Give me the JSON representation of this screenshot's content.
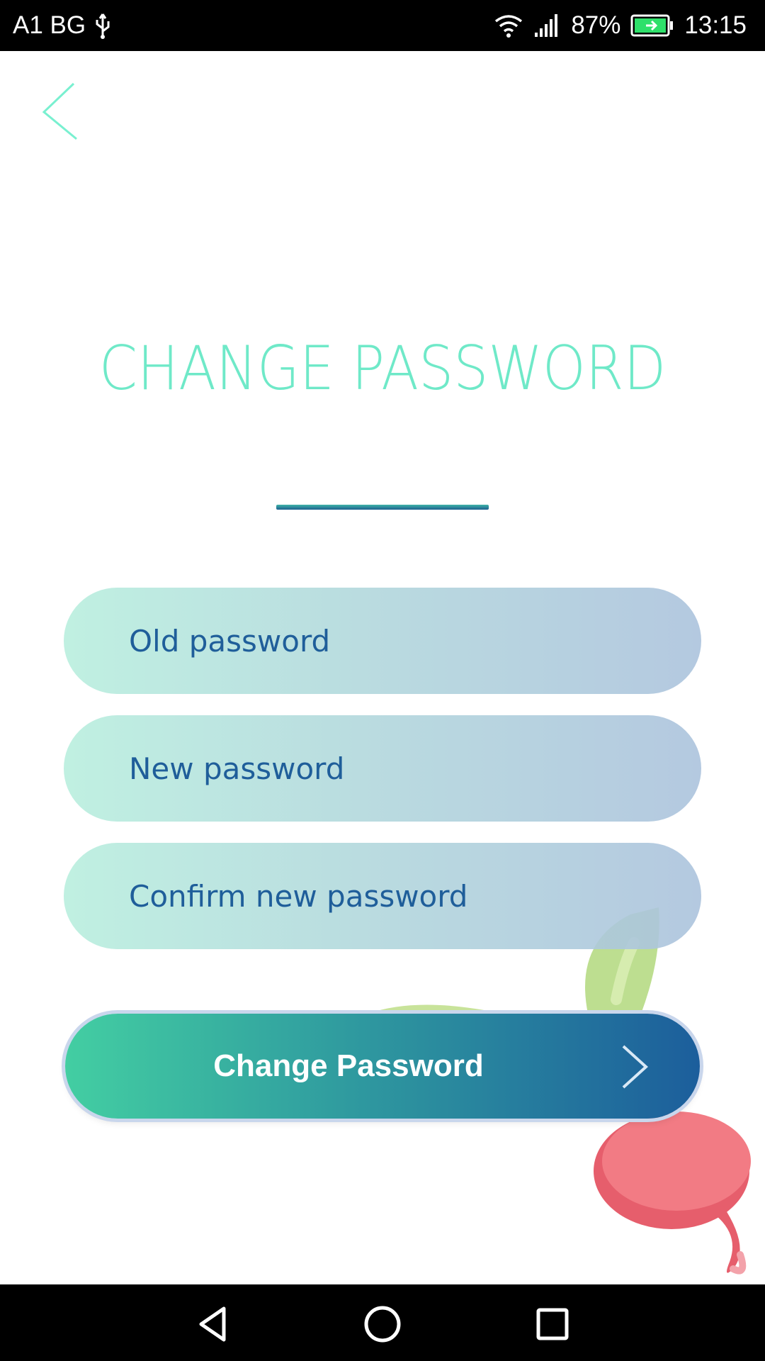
{
  "status_bar": {
    "carrier": "A1 BG",
    "battery_percent": "87%",
    "time": "13:15",
    "icons": [
      "usb-icon",
      "wifi-icon",
      "signal-icon",
      "battery-charging-icon"
    ]
  },
  "header": {
    "back_icon": "chevron-left-icon",
    "title": "CHANGE PASSWORD"
  },
  "form": {
    "old_password_placeholder": "Old password",
    "new_password_placeholder": "New password",
    "confirm_password_placeholder": "Confirm new password",
    "submit_label": "Change Password",
    "submit_icon": "chevron-right-icon"
  },
  "nav_bar": {
    "icons": [
      "nav-back-icon",
      "nav-home-icon",
      "nav-recents-icon"
    ]
  },
  "colors": {
    "title": "#6fe9c8",
    "field_text": "#1f5e9a",
    "button_start": "#43cea2",
    "button_end": "#1c5e9c"
  }
}
